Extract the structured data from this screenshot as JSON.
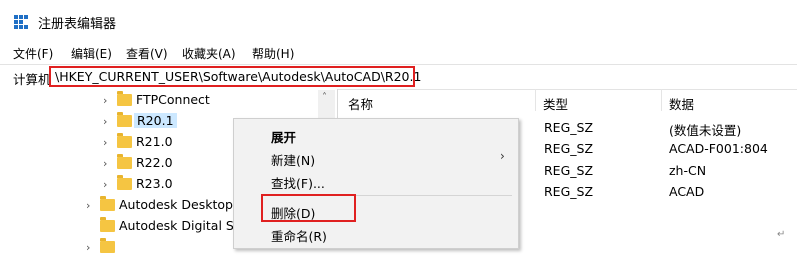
{
  "window": {
    "title": "注册表编辑器"
  },
  "menu": [
    "文件(F)",
    "编辑(E)",
    "查看(V)",
    "收藏夹(A)",
    "帮助(H)"
  ],
  "address": {
    "prefix": "计算机",
    "path": "\\HKEY_CURRENT_USER\\Software\\Autodesk\\AutoCAD\\R20.1"
  },
  "tree": [
    {
      "label": "FTPConnect"
    },
    {
      "label": "R20.1"
    },
    {
      "label": "R21.0"
    },
    {
      "label": "R22.0"
    },
    {
      "label": "R23.0"
    },
    {
      "label": "Autodesk Desktop"
    },
    {
      "label": "Autodesk Digital Si"
    },
    {
      "label": ""
    }
  ],
  "list": {
    "headers": [
      "名称",
      "类型",
      "数据"
    ],
    "rows": [
      {
        "type": "REG_SZ",
        "data": "(数值未设置)"
      },
      {
        "type": "REG_SZ",
        "data": "ACAD-F001:804"
      },
      {
        "type": "REG_SZ",
        "data": "zh-CN"
      },
      {
        "type": "REG_SZ",
        "data": "ACAD"
      }
    ]
  },
  "context_menu": {
    "items": [
      "展开",
      "新建(N)",
      "查找(F)...",
      "删除(D)",
      "重命名(R)"
    ],
    "submenu_arrow": "›"
  },
  "icons": {
    "tree_expand": "›",
    "scroll_up": "˄",
    "corner": "↵"
  },
  "colors": {
    "highlight_red": "#e02020",
    "selection_blue": "#cce8ff",
    "folder_yellow": "#f5c542"
  }
}
